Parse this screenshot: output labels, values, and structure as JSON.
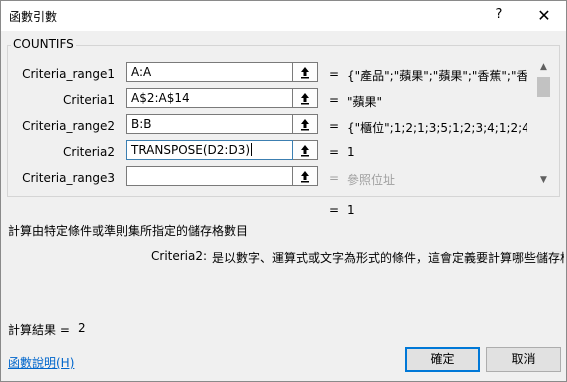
{
  "window": {
    "title": "函數引數",
    "help": "?",
    "close": "✕"
  },
  "function_name": "COUNTIFS",
  "args": [
    {
      "label": "Criteria_range1",
      "value": "A:A",
      "result": "{\"產品\";\"蘋果\";\"蘋果\";\"香蕉\";\"香蕉\";"
    },
    {
      "label": "Criteria1",
      "value": "A$2:A$14",
      "result": "\"蘋果\""
    },
    {
      "label": "Criteria_range2",
      "value": "B:B",
      "result": "{\"櫃位\";1;2;1;3;5;1;2;3;4;1;2;4;5;0;0..."
    },
    {
      "label": "Criteria2",
      "value": "TRANSPOSE(D2:D3)",
      "result": "1"
    },
    {
      "label": "Criteria_range3",
      "value": "",
      "result": "參照位址"
    }
  ],
  "equals": "=",
  "formula_result": "1",
  "description": "計算由特定條件或準則集所指定的儲存格數目",
  "param_help": {
    "name": "Criteria2:",
    "text": "是以數字、運算式或文字為形式的條件，這會定義要計算哪些儲存格"
  },
  "calc_result": {
    "label": "計算結果 =",
    "value": "2"
  },
  "help_link": "函數說明(H)",
  "buttons": {
    "ok": "確定",
    "cancel": "取消"
  },
  "scrollbar": {
    "up": "▲",
    "down": "▼"
  }
}
